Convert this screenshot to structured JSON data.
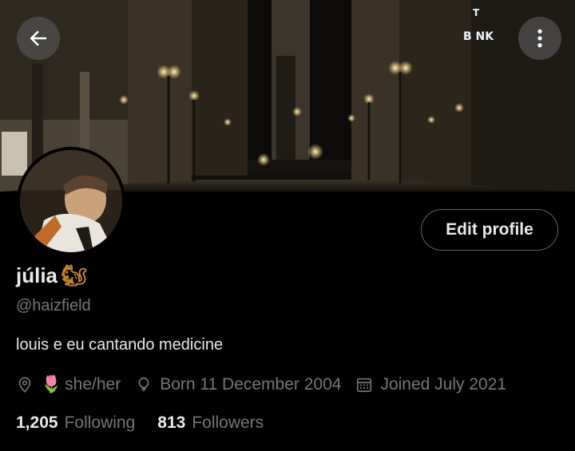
{
  "profile": {
    "display_name": "júlia",
    "name_emoji": "🐿",
    "handle": "@haizfield",
    "bio": "louis e eu cantando medicine",
    "pronoun_emoji": "🌷",
    "pronouns": "she/her",
    "birthday": "Born 11 December 2004",
    "joined": "Joined July 2021"
  },
  "stats": {
    "following_count": "1,205",
    "following_label": "Following",
    "followers_count": "813",
    "followers_label": "Followers"
  },
  "actions": {
    "edit_profile": "Edit profile"
  },
  "banner": {
    "sign_text": "B NK"
  },
  "colors": {
    "background": "#000000",
    "text_primary": "#e7e9ea",
    "text_secondary": "#71767b",
    "button_border": "#536471"
  },
  "icons": [
    "back-arrow-icon",
    "more-vertical-icon",
    "location-icon",
    "birthday-balloon-icon",
    "calendar-icon"
  ]
}
